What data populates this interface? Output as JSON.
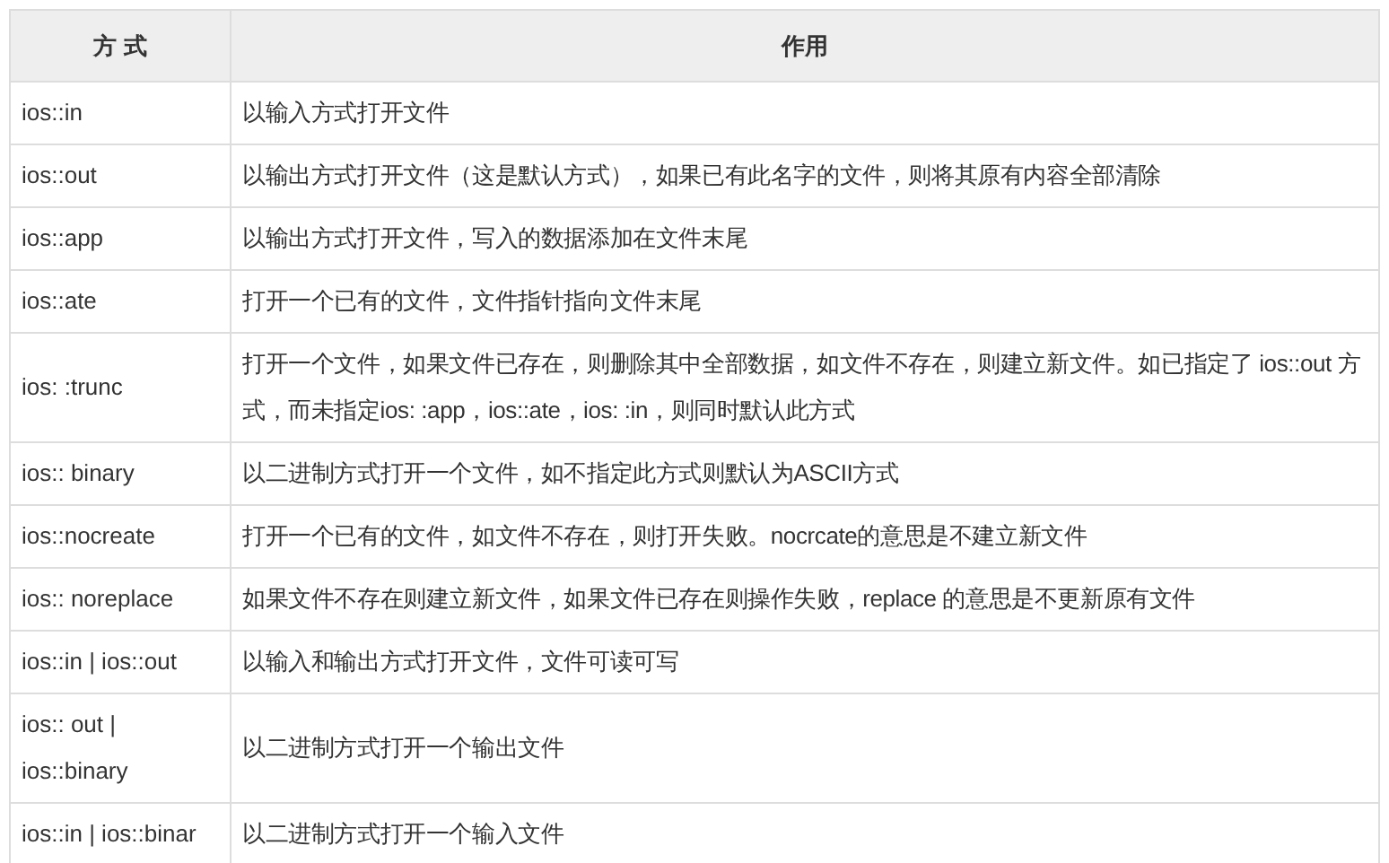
{
  "table": {
    "columns": [
      "方 式",
      "作用"
    ],
    "rows": [
      {
        "mode": "ios::in",
        "effect": "以输入方式打开文件"
      },
      {
        "mode": "ios::out",
        "effect": "以输出方式打开文件（这是默认方式），如果已有此名字的文件，则将其原有内容全部清除"
      },
      {
        "mode": "ios::app",
        "effect": "以输出方式打开文件，写入的数据添加在文件末尾"
      },
      {
        "mode": "ios::ate",
        "effect": "打开一个已有的文件，文件指针指向文件末尾"
      },
      {
        "mode": "ios: :trunc",
        "effect": "打开一个文件，如果文件已存在，则删除其中全部数据，如文件不存在，则建立新文件。如已指定了 ios::out 方式，而未指定ios: :app，ios::ate，ios: :in，则同时默认此方式"
      },
      {
        "mode": "ios:: binary",
        "effect": "以二进制方式打开一个文件，如不指定此方式则默认为ASCII方式"
      },
      {
        "mode": "ios::nocreate",
        "effect": "打开一个已有的文件，如文件不存在，则打开失败。nocrcate的意思是不建立新文件"
      },
      {
        "mode": "ios:: noreplace",
        "effect": "如果文件不存在则建立新文件，如果文件已存在则操作失败，replace 的意思是不更新原有文件"
      },
      {
        "mode": "ios::in | ios::out",
        "effect": "以输入和输出方式打开文件，文件可读可写"
      },
      {
        "mode": "ios:: out | ios::binary",
        "effect": "以二进制方式打开一个输出文件"
      },
      {
        "mode": "ios::in | ios::binar",
        "effect": "以二进制方式打开一个输入文件"
      }
    ]
  }
}
